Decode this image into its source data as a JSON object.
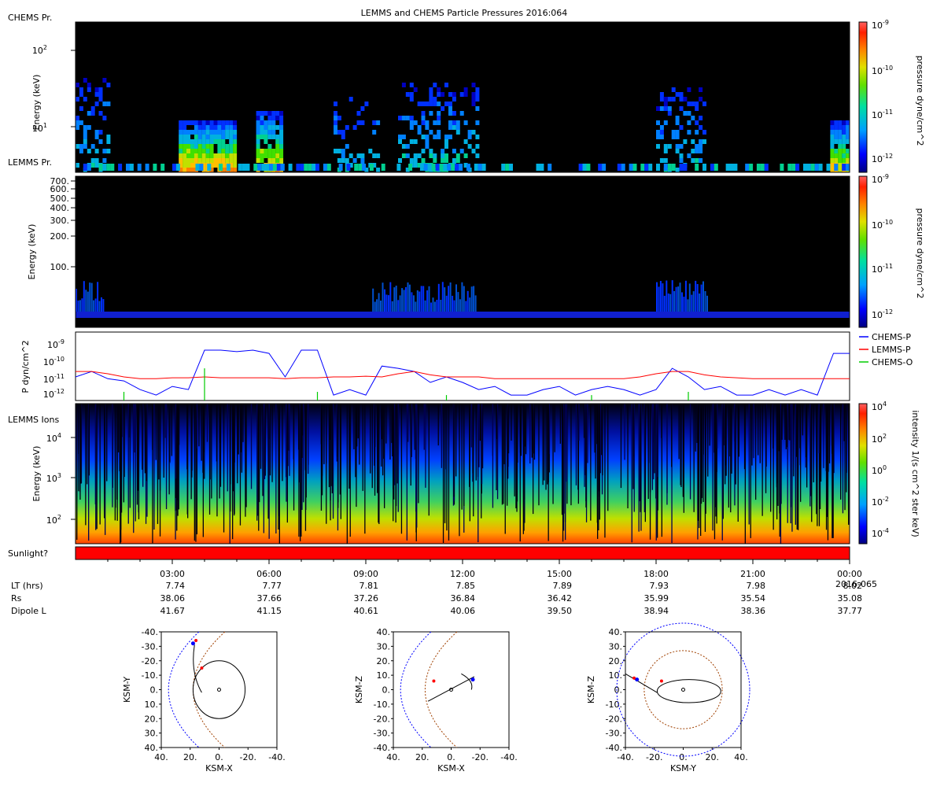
{
  "title": "LEMMS and CHEMS Particle Pressures  2016:064",
  "colors": {
    "background": "#000000",
    "chems_p": "#0000ff",
    "lemms_p": "#ff0000",
    "chems_o": "#00cc00",
    "sunlight_bar": "#ff0000"
  },
  "panels": {
    "chems": {
      "name": "CHEMS Pr.",
      "ylabel": "Energy (keV)",
      "yticks": [
        "10",
        "10"
      ],
      "yticks_exp": [
        "2",
        "1"
      ],
      "cbar_label": "pressure dyne/cm^2",
      "cbar_ticks": [
        "10",
        "10",
        "10",
        "10"
      ],
      "cbar_exps": [
        "-9",
        "-10",
        "-11",
        "-12"
      ]
    },
    "lemms": {
      "name": "LEMMS Pr.",
      "ylabel": "Energy (keV)",
      "yticks": [
        "700.",
        "600.",
        "500.",
        "400.",
        "300.",
        "200.",
        "100."
      ],
      "cbar_label": "pressure dyne/cm^2",
      "cbar_ticks": [
        "10",
        "10",
        "10",
        "10"
      ],
      "cbar_exps": [
        "-9",
        "-10",
        "-11",
        "-12"
      ]
    },
    "pressure": {
      "ylabel": "P dyn/cm^2",
      "yticks": [
        "10",
        "10",
        "10",
        "10"
      ],
      "yticks_exp": [
        "-9",
        "-10",
        "-11",
        "-12"
      ],
      "legend": [
        "CHEMS-P",
        "LEMMS-P",
        "CHEMS-O"
      ]
    },
    "ions": {
      "name": "LEMMS Ions",
      "ylabel": "Energy (keV)",
      "yticks": [
        "10",
        "10",
        "10"
      ],
      "yticks_exp": [
        "4",
        "3",
        "2"
      ],
      "cbar_label": "intensity 1/(s cm^2 ster keV)",
      "cbar_ticks": [
        "10",
        "10",
        "10",
        "10",
        "10"
      ],
      "cbar_exps": [
        "4",
        "2",
        "0",
        "-2",
        "-4"
      ]
    },
    "sunlight": {
      "name": "Sunlight?"
    }
  },
  "time_axis": {
    "ticks": [
      "03:00",
      "06:00",
      "09:00",
      "12:00",
      "15:00",
      "18:00",
      "21:00",
      "00:00"
    ],
    "end_date": "2016-065",
    "rows": [
      {
        "name": "LT (hrs)",
        "values": [
          "7.74",
          "7.77",
          "7.81",
          "7.85",
          "7.89",
          "7.93",
          "7.98",
          "8.02"
        ]
      },
      {
        "name": "Rs",
        "values": [
          "38.06",
          "37.66",
          "37.26",
          "36.84",
          "36.42",
          "35.99",
          "35.54",
          "35.08"
        ]
      },
      {
        "name": "Dipole L",
        "values": [
          "41.67",
          "41.15",
          "40.61",
          "40.06",
          "39.50",
          "38.94",
          "38.36",
          "37.77"
        ]
      }
    ]
  },
  "orbits": [
    {
      "xlabel": "KSM-X",
      "ylabel": "KSM-Y",
      "xticks": [
        "40.",
        "20.",
        "0.",
        "-20.",
        "-40."
      ],
      "yticks": [
        "-40.",
        "-30.",
        "-20.",
        "-10.",
        "0.",
        "10.",
        "20.",
        "30.",
        "40."
      ]
    },
    {
      "xlabel": "KSM-X",
      "ylabel": "KSM-Z",
      "xticks": [
        "40.",
        "20.",
        "0.",
        "-20.",
        "-40."
      ],
      "yticks": [
        "40.",
        "30.",
        "20.",
        "10.",
        "0.",
        "-10.",
        "-20.",
        "-30.",
        "-40."
      ]
    },
    {
      "xlabel": "KSM-Y",
      "ylabel": "KSM-Z",
      "xticks": [
        "-40.",
        "-20.",
        "0.",
        "20.",
        "40."
      ],
      "yticks": [
        "40.",
        "30.",
        "20.",
        "10.",
        "0.",
        "-10.",
        "-20.",
        "-30.",
        "-40."
      ]
    }
  ],
  "chart_data": {
    "type": "line",
    "title": "LEMMS and CHEMS Particle Pressures  2016:064",
    "xlabel": "",
    "ylabel": "P dyn/cm^2",
    "log_y": true,
    "ylim": [
      5e-13,
      3e-09
    ],
    "x_hours": [
      0,
      0.5,
      1,
      1.5,
      2,
      2.5,
      3,
      3.5,
      4,
      4.5,
      5,
      5.5,
      6,
      6.5,
      7,
      7.5,
      8,
      8.5,
      9,
      9.5,
      10,
      10.5,
      11,
      11.5,
      12,
      12.5,
      13,
      13.5,
      14,
      14.5,
      15,
      15.5,
      16,
      16.5,
      17,
      17.5,
      18,
      18.5,
      19,
      19.5,
      20,
      20.5,
      21,
      21.5,
      22,
      22.5,
      23,
      23.5,
      24
    ],
    "series": [
      {
        "name": "CHEMS-P",
        "values": [
          1e-11,
          2e-11,
          8e-12,
          6e-12,
          2e-12,
          1e-12,
          3e-12,
          2e-12,
          3e-10,
          3e-10,
          2.5e-10,
          3e-10,
          2e-10,
          1e-11,
          3e-10,
          3e-10,
          1e-12,
          2e-12,
          1e-12,
          4e-11,
          3e-11,
          2e-11,
          5e-12,
          1e-11,
          5e-12,
          2e-12,
          3e-12,
          1e-12,
          1e-12,
          2e-12,
          3e-12,
          1e-12,
          2e-12,
          3e-12,
          2e-12,
          1e-12,
          2e-12,
          3e-11,
          1e-11,
          2e-12,
          3e-12,
          1e-12,
          1e-12,
          2e-12,
          1e-12,
          2e-12,
          1e-12,
          2e-10,
          2e-10
        ]
      },
      {
        "name": "LEMMS-P",
        "values": [
          2e-11,
          2e-11,
          1.5e-11,
          1e-11,
          8e-12,
          8e-12,
          9e-12,
          9e-12,
          1e-11,
          9e-12,
          9e-12,
          9e-12,
          9e-12,
          8e-12,
          9e-12,
          9e-12,
          1e-11,
          1e-11,
          1.1e-11,
          1e-11,
          1.5e-11,
          2e-11,
          1.3e-11,
          1e-11,
          1e-11,
          1e-11,
          8e-12,
          8e-12,
          8e-12,
          8e-12,
          8e-12,
          8e-12,
          8e-12,
          8e-12,
          8e-12,
          1e-11,
          1.5e-11,
          2e-11,
          2e-11,
          1.3e-11,
          1e-11,
          9e-12,
          8e-12,
          8e-12,
          8e-12,
          8e-12,
          8e-12,
          8e-12,
          8e-12
        ]
      },
      {
        "name": "CHEMS-O",
        "values": [
          null,
          null,
          null,
          1.5e-12,
          null,
          null,
          null,
          null,
          3e-11,
          null,
          null,
          null,
          null,
          null,
          null,
          1.5e-12,
          null,
          null,
          null,
          null,
          null,
          null,
          null,
          1e-12,
          null,
          null,
          null,
          null,
          null,
          null,
          null,
          null,
          1e-12,
          null,
          null,
          null,
          null,
          null,
          1.5e-12,
          null,
          null,
          null,
          null,
          null,
          null,
          null,
          null,
          null,
          null
        ]
      }
    ]
  }
}
